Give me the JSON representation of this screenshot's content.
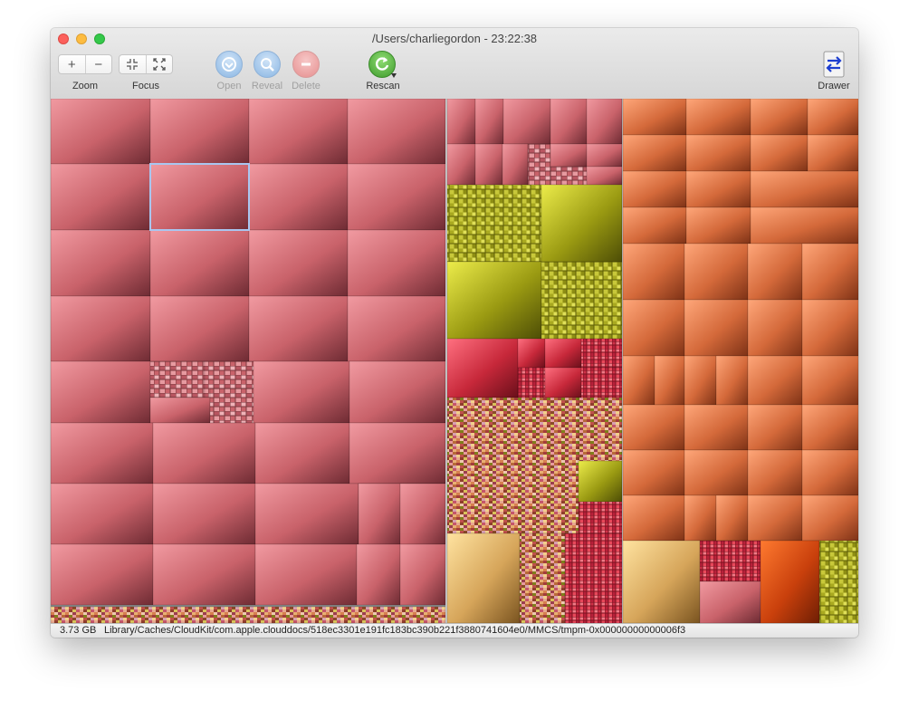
{
  "window": {
    "title": "/Users/charliegordon - 23:22:38"
  },
  "toolbar": {
    "zoom_label": "Zoom",
    "zoom_in_symbol": "+",
    "zoom_out_symbol": "−",
    "focus_label": "Focus",
    "open_label": "Open",
    "reveal_label": "Reveal",
    "delete_label": "Delete",
    "rescan_label": "Rescan",
    "drawer_label": "Drawer"
  },
  "status": {
    "size": "3.73 GB",
    "path": "Library/Caches/CloudKit/com.apple.clouddocs/518ec3301e191fc183bc390b221f3880741604e0/MMCS/tmpm-0x00000000000006f3"
  },
  "colors": {
    "pink": "#c9626a",
    "olive": "#8f8f10",
    "red": "#c7283a",
    "orange": "#d4693a",
    "tan": "#d6a55a",
    "selection": "#a9c6f0"
  },
  "icons": {
    "open": "open-arrow-icon",
    "reveal": "magnifier-icon",
    "delete": "minus-icon",
    "rescan": "refresh-icon",
    "drawer": "drawer-swap-icon"
  }
}
